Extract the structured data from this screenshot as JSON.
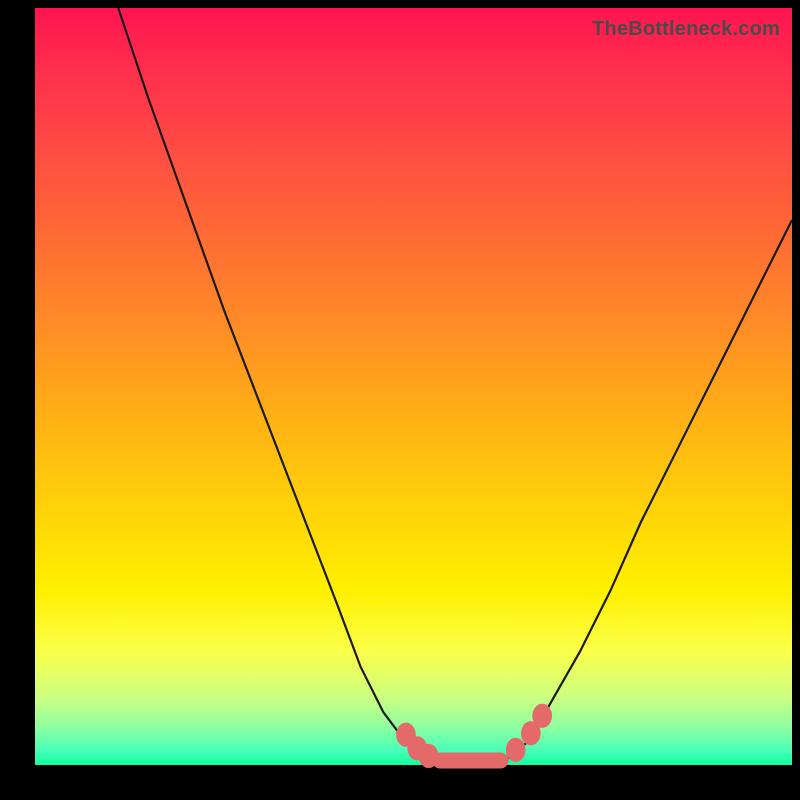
{
  "watermark": "TheBottleneck.com",
  "colors": {
    "marker": "#e46a6a",
    "curve": "#1a1a1a",
    "background_black": "#000000"
  },
  "chart_data": {
    "type": "line",
    "title": "",
    "xlabel": "",
    "ylabel": "",
    "xlim": [
      0,
      100
    ],
    "ylim": [
      0,
      100
    ],
    "grid": false,
    "legend": false,
    "series": [
      {
        "name": "left-curve",
        "x": [
          11,
          15,
          20,
          25,
          30,
          35,
          40,
          43,
          46,
          49,
          52,
          54
        ],
        "y": [
          100,
          88,
          74,
          60,
          47,
          34,
          21,
          13,
          7,
          3,
          1,
          0.5
        ]
      },
      {
        "name": "right-curve",
        "x": [
          62,
          65,
          68,
          72,
          76,
          80,
          85,
          90,
          95,
          100
        ],
        "y": [
          0.5,
          3,
          8,
          15,
          23,
          32,
          42,
          52,
          62,
          72
        ]
      }
    ],
    "markers": {
      "name": "threshold-markers",
      "points": [
        {
          "x": 49.0,
          "y": 4.0
        },
        {
          "x": 50.5,
          "y": 2.2
        },
        {
          "x": 52.0,
          "y": 1.2
        },
        {
          "x": 63.5,
          "y": 2.0
        },
        {
          "x": 65.5,
          "y": 4.2
        },
        {
          "x": 67.0,
          "y": 6.5
        }
      ]
    },
    "minimum_band": {
      "x_start": 53.5,
      "x_end": 61.5,
      "y": 0.6
    },
    "gradient_stops": [
      {
        "pos": 0,
        "color": "#ff1450"
      },
      {
        "pos": 50,
        "color": "#ff9a1e"
      },
      {
        "pos": 78,
        "color": "#fff000"
      },
      {
        "pos": 100,
        "color": "#11ff9e"
      }
    ]
  }
}
